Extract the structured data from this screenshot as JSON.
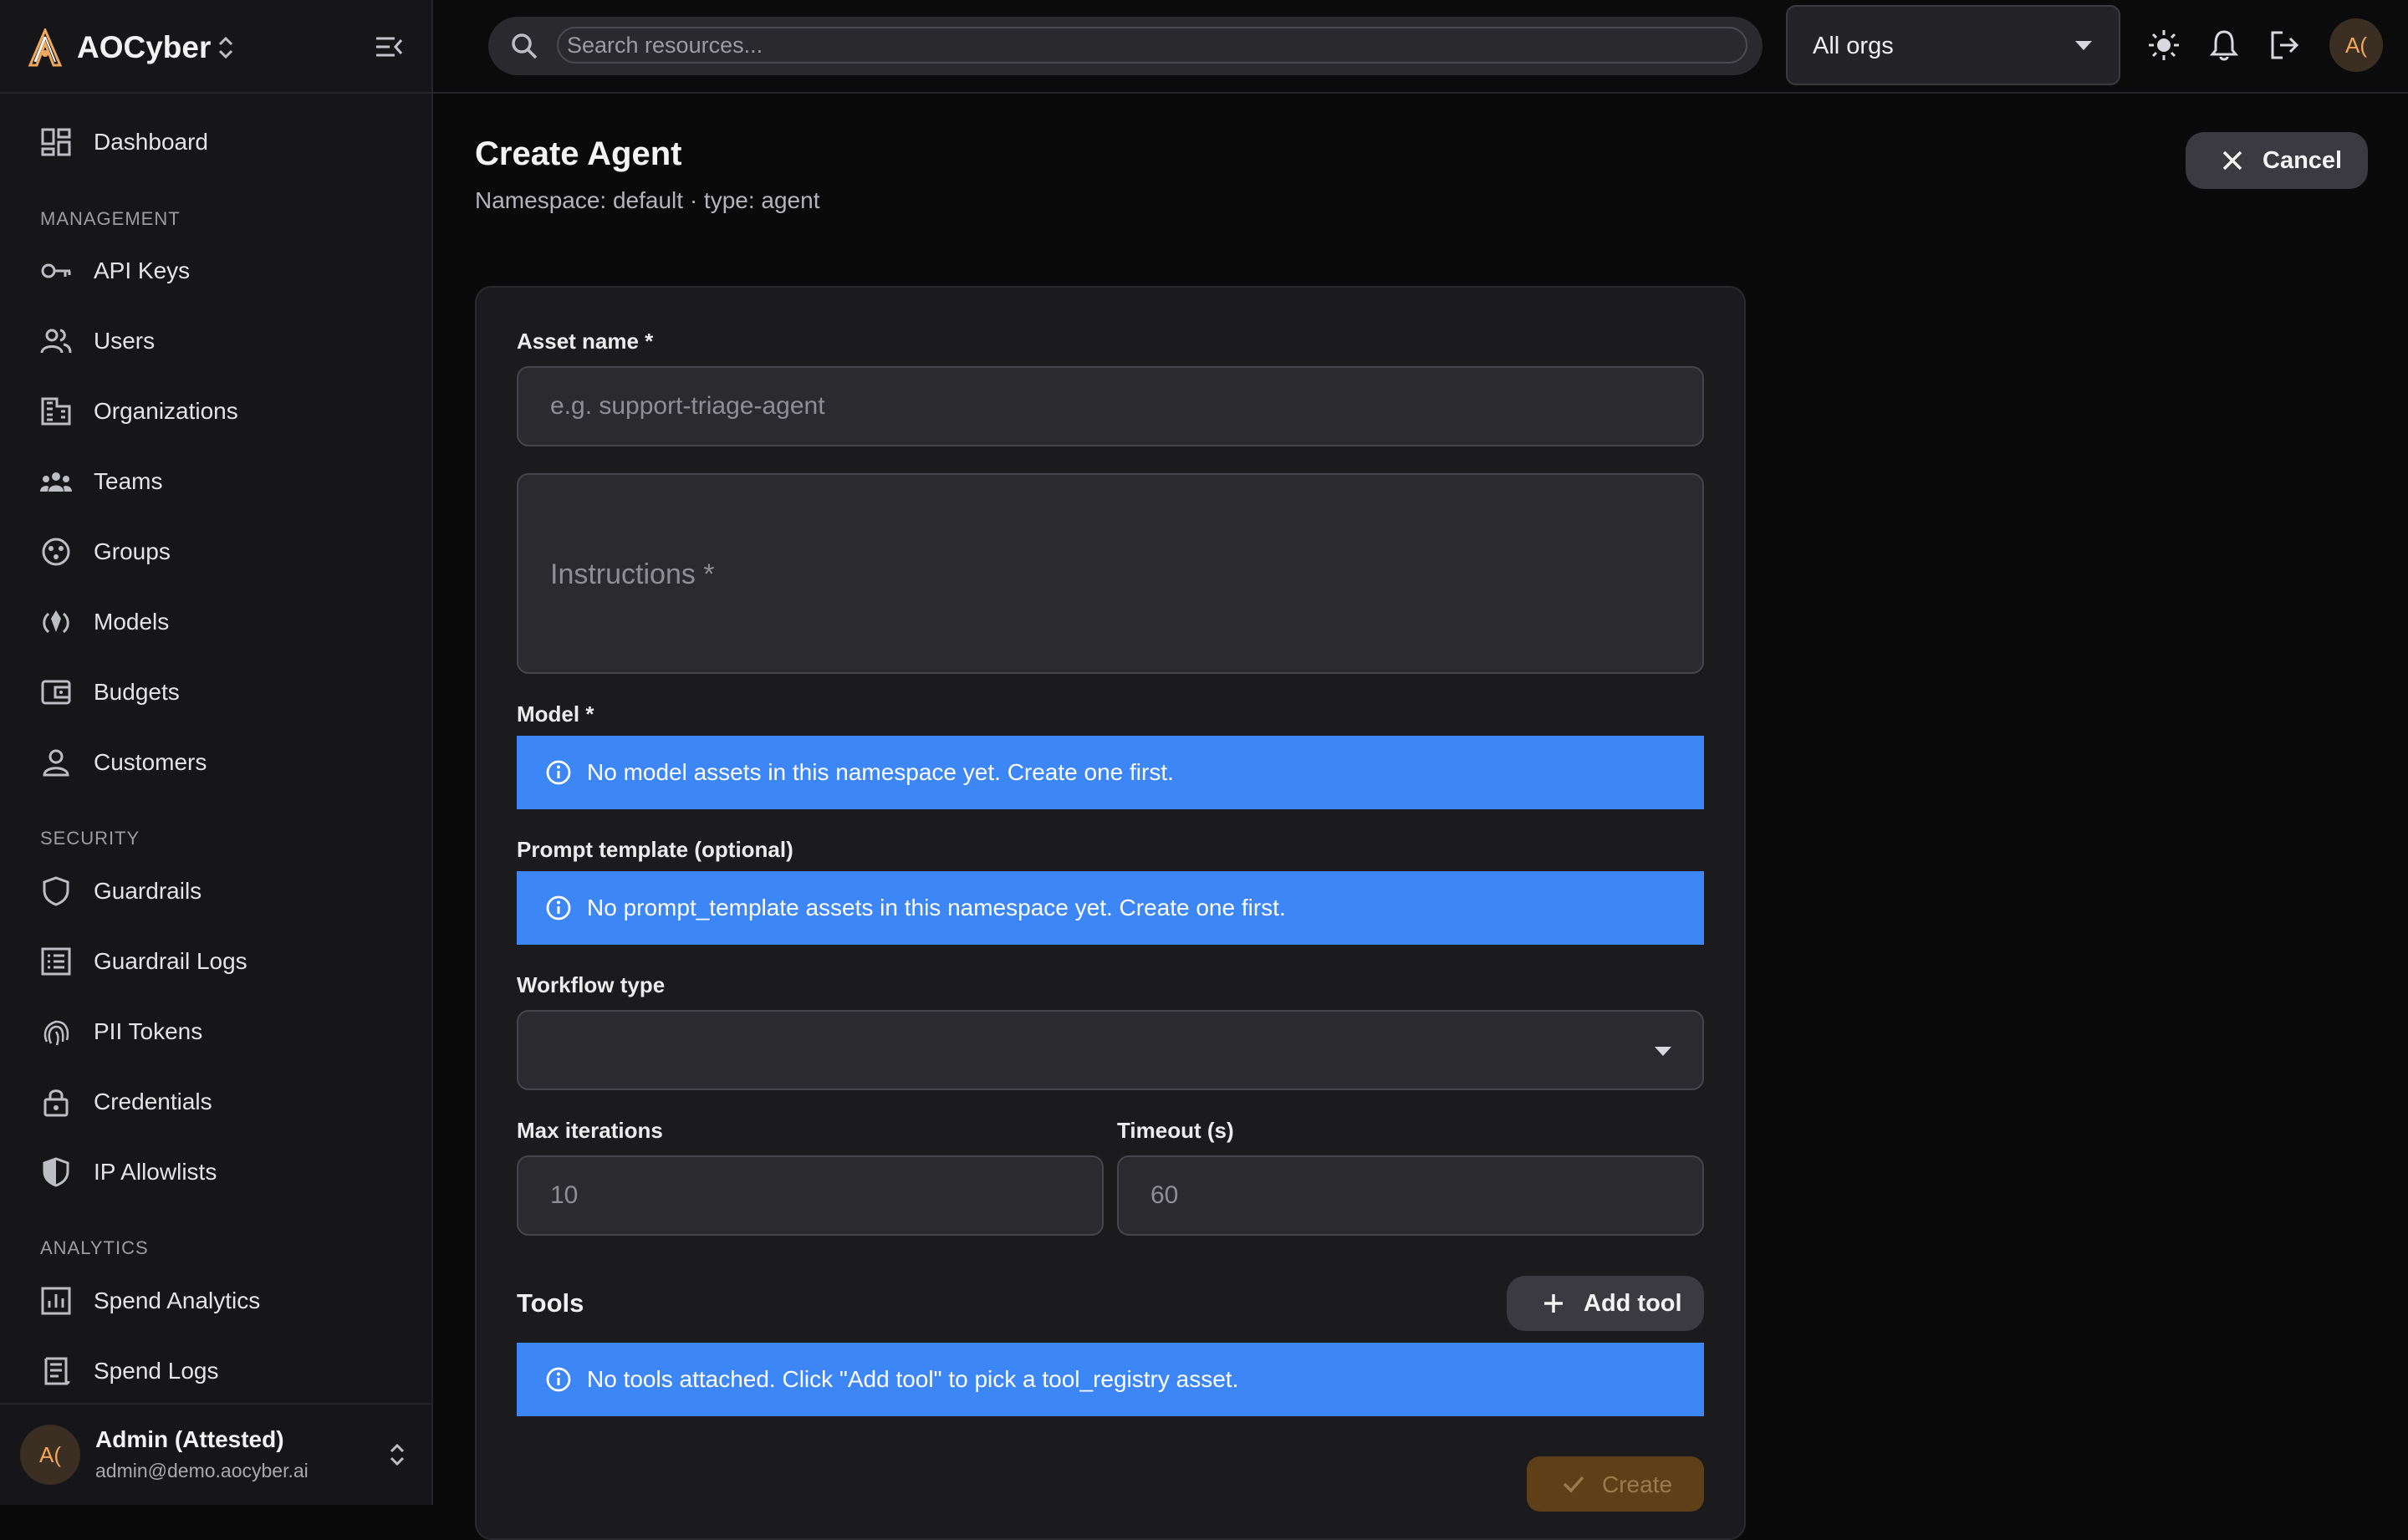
{
  "app": {
    "name": "AOCyber"
  },
  "sidebar": {
    "dashboard": "Dashboard",
    "sections": {
      "management": "MANAGEMENT",
      "security": "SECURITY",
      "analytics": "ANALYTICS"
    },
    "management_items": [
      "API Keys",
      "Users",
      "Organizations",
      "Teams",
      "Groups",
      "Models",
      "Budgets",
      "Customers"
    ],
    "security_items": [
      "Guardrails",
      "Guardrail Logs",
      "PII Tokens",
      "Credentials",
      "IP Allowlists"
    ],
    "analytics_items": [
      "Spend Analytics",
      "Spend Logs"
    ],
    "user": {
      "initials": "A(",
      "name": "Admin (Attested)",
      "email": "admin@demo.aocyber.ai"
    }
  },
  "topbar": {
    "search_placeholder": "Search resources...",
    "org_select": "All orgs",
    "avatar_initials": "A("
  },
  "page": {
    "title": "Create Agent",
    "subtitle": "Namespace: default · type: agent",
    "cancel_label": "Cancel"
  },
  "form": {
    "asset_name_label": "Asset name *",
    "asset_name_placeholder": "e.g. support-triage-agent",
    "instructions_placeholder": "Instructions *",
    "model_label": "Model *",
    "model_alert": "No model assets in this namespace yet. Create one first.",
    "prompt_label": "Prompt template (optional)",
    "prompt_alert": "No prompt_template assets in this namespace yet. Create one first.",
    "workflow_label": "Workflow type",
    "workflow_value": "",
    "max_iter_label": "Max iterations",
    "max_iter_placeholder": "10",
    "timeout_label": "Timeout (s)",
    "timeout_placeholder": "60",
    "tools_title": "Tools",
    "add_tool_label": "Add tool",
    "tools_alert": "No tools attached. Click \"Add tool\" to pick a tool_registry asset.",
    "create_label": "Create"
  },
  "colors": {
    "accent": "#f0a85a",
    "alert_blue": "#3d86f6",
    "create_disabled": "#5e3f18"
  }
}
